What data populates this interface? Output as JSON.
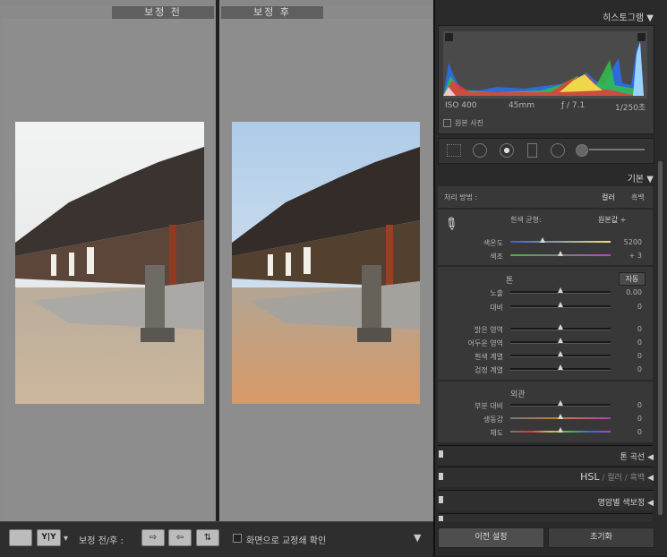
{
  "compare": {
    "before_title": "보정 전",
    "after_title": "보정 후"
  },
  "toolbar": {
    "compare_label": "보정 전/후 :",
    "yy_label": "Y|Y",
    "checkbox_label": "화면으로 교정쇄 확인"
  },
  "histogram": {
    "title": "히스토그램",
    "iso": "ISO 400",
    "focal": "45mm",
    "aperture": "ƒ / 7.1",
    "shutter": "1/250초",
    "original_photo": "원본 사진"
  },
  "basic": {
    "title": "기본",
    "treatment_label": "처리 방법 :",
    "treatment_color": "컬러",
    "treatment_bw": "흑백",
    "wb_label": "흰색 균형:",
    "wb_value": "원본값 ÷",
    "temp_label": "색온도",
    "temp_value": "5200",
    "tint_label": "색조",
    "tint_value": "+ 3",
    "tone_title": "톤",
    "auto_label": "자동",
    "exposure_label": "노출",
    "exposure_value": "0.00",
    "contrast_label": "대비",
    "contrast_value": "0",
    "highlights_label": "밝은 영역",
    "highlights_value": "0",
    "shadows_label": "어두운 영역",
    "shadows_value": "0",
    "whites_label": "흰색 계열",
    "whites_value": "0",
    "blacks_label": "검정 계열",
    "blacks_value": "0",
    "presence_title": "외관",
    "clarity_label": "부분 대비",
    "clarity_value": "0",
    "vibrance_label": "생동감",
    "vibrance_value": "0",
    "saturation_label": "채도",
    "saturation_value": "0"
  },
  "panels": {
    "tone_curve": "톤 곡선",
    "hsl": "HSL",
    "hsl_color": "컬러",
    "hsl_bw": "흑백",
    "split_toning": "명암별 색보정"
  },
  "buttons": {
    "previous": "이전 설정",
    "reset": "초기화"
  }
}
